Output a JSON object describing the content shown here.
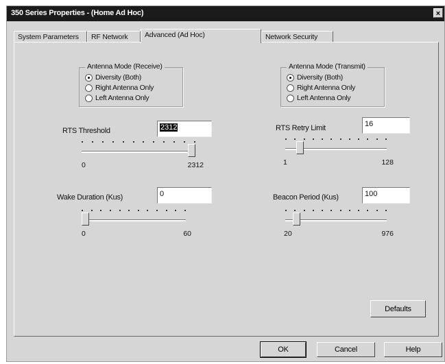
{
  "window": {
    "title": "350 Series Properties - (Home Ad Hoc)",
    "close_glyph": "×"
  },
  "tabs": [
    {
      "label": "System Parameters"
    },
    {
      "label": "RF Network"
    },
    {
      "label": "Advanced (Ad Hoc)"
    },
    {
      "label": "Network Security"
    }
  ],
  "active_tab": "Advanced (Ad Hoc)",
  "antenna_receive": {
    "title": "Antenna Mode (Receive)",
    "options": [
      {
        "label": "Diversity (Both)",
        "checked": true
      },
      {
        "label": "Right Antenna Only",
        "checked": false
      },
      {
        "label": "Left Antenna Only",
        "checked": false
      }
    ]
  },
  "antenna_transmit": {
    "title": "Antenna Mode (Transmit)",
    "options": [
      {
        "label": "Diversity (Both)",
        "checked": true
      },
      {
        "label": "Right Antenna Only",
        "checked": false
      },
      {
        "label": "Left Antenna Only",
        "checked": false
      }
    ]
  },
  "rts_threshold": {
    "label": "RTS Threshold",
    "value": "2312",
    "min": "0",
    "max": "2312",
    "level": 1.0
  },
  "rts_retry_limit": {
    "label": "RTS Retry Limit",
    "value": "16",
    "min": "1",
    "max": "128",
    "level": 0.12
  },
  "wake_duration": {
    "label": "Wake Duration (Kus)",
    "value": "0",
    "min": "0",
    "max": "60",
    "level": 0.0
  },
  "beacon_period": {
    "label": "Beacon Period (Kus)",
    "value": "100",
    "min": "20",
    "max": "976",
    "level": 0.08
  },
  "buttons": {
    "defaults": "Defaults",
    "ok": "OK",
    "cancel": "Cancel",
    "help": "Help"
  },
  "icons": {
    "radio_button": "radio-button-icon",
    "close": "close-icon"
  }
}
